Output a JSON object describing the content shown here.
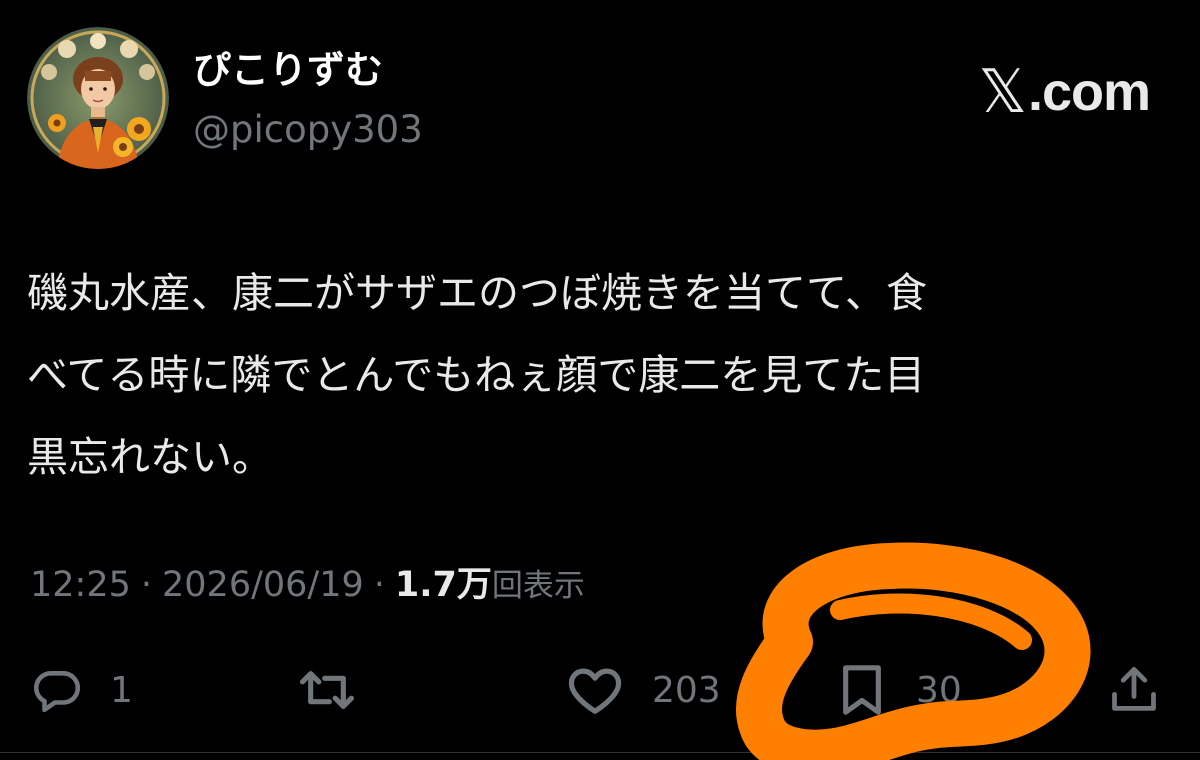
{
  "brand": {
    "x_glyph": "𝕏",
    "suffix": ".com"
  },
  "author": {
    "display_name": "ぴこりずむ",
    "handle": "@picopy303"
  },
  "tweet": {
    "text": "磯丸水産、康二がサザエのつぼ焼きを当てて、食\nべてる時に隣でとんでもねぇ顔で康二を見てた目\n黒忘れない。"
  },
  "meta": {
    "time": "12:25",
    "separator": "·",
    "date": "2026/06/19",
    "views_count": "1.7万",
    "views_label": "回表示"
  },
  "actions": {
    "reply": {
      "icon": "reply-icon",
      "count": "1"
    },
    "retweet": {
      "icon": "retweet-icon",
      "count": ""
    },
    "like": {
      "icon": "heart-icon",
      "count": "203"
    },
    "bookmark": {
      "icon": "bookmark-icon",
      "count": "30"
    },
    "share": {
      "icon": "share-icon",
      "count": ""
    }
  },
  "colors": {
    "background": "#000000",
    "text_primary": "#e7e9ea",
    "text_secondary": "#71767b",
    "highlight": "#ff8000"
  }
}
